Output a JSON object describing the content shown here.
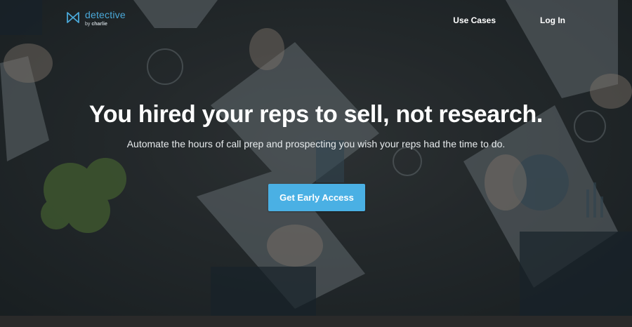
{
  "brand": {
    "name": "detective",
    "byline_prefix": "by",
    "byline_name": "charlie",
    "icon": "bowtie-icon",
    "color": "#4aa8d8"
  },
  "nav": {
    "use_cases": "Use Cases",
    "log_in": "Log In"
  },
  "hero": {
    "headline": "You hired your reps to sell, not research.",
    "subheadline": "Automate the hours of call prep and prospecting you wish your reps had the time to do.",
    "cta_label": "Get Early Access",
    "cta_color": "#4ab0e4"
  }
}
